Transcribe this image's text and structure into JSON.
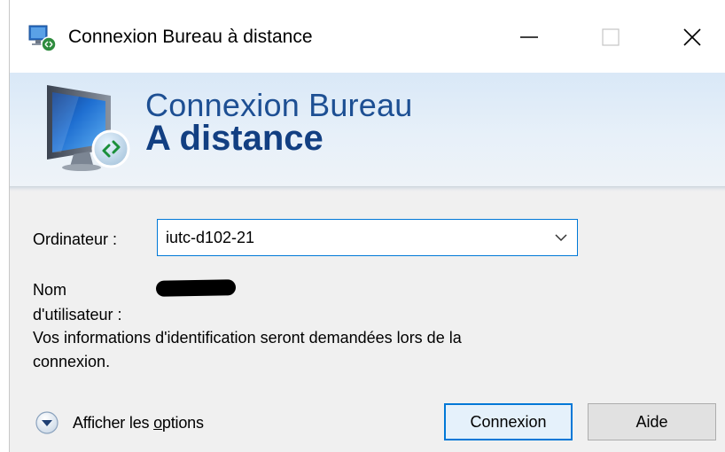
{
  "window": {
    "title": "Connexion Bureau à distance"
  },
  "banner": {
    "line1": "Connexion Bureau",
    "line2": "A distance"
  },
  "form": {
    "computer_label": "Ordinateur :",
    "computer_value": "iutc-d102-21",
    "username_label_line1": "Nom",
    "username_label_line2": "d'utilisateur :",
    "info_line1": "Vos informations d'identification seront demandées lors de la",
    "info_line2": "connexion."
  },
  "footer": {
    "options_label_pre": "Afficher les ",
    "options_label_accel": "o",
    "options_label_post": "ptions",
    "connect_label": "Connexion",
    "help_label": "Aide"
  },
  "colors": {
    "accent": "#0078d7",
    "banner_text": "#1d4f93"
  },
  "icons": [
    "remote-desktop-app-icon",
    "minimize-icon",
    "maximize-icon",
    "close-icon",
    "monitor-connection-icon",
    "chevron-down-icon",
    "expand-options-icon"
  ]
}
